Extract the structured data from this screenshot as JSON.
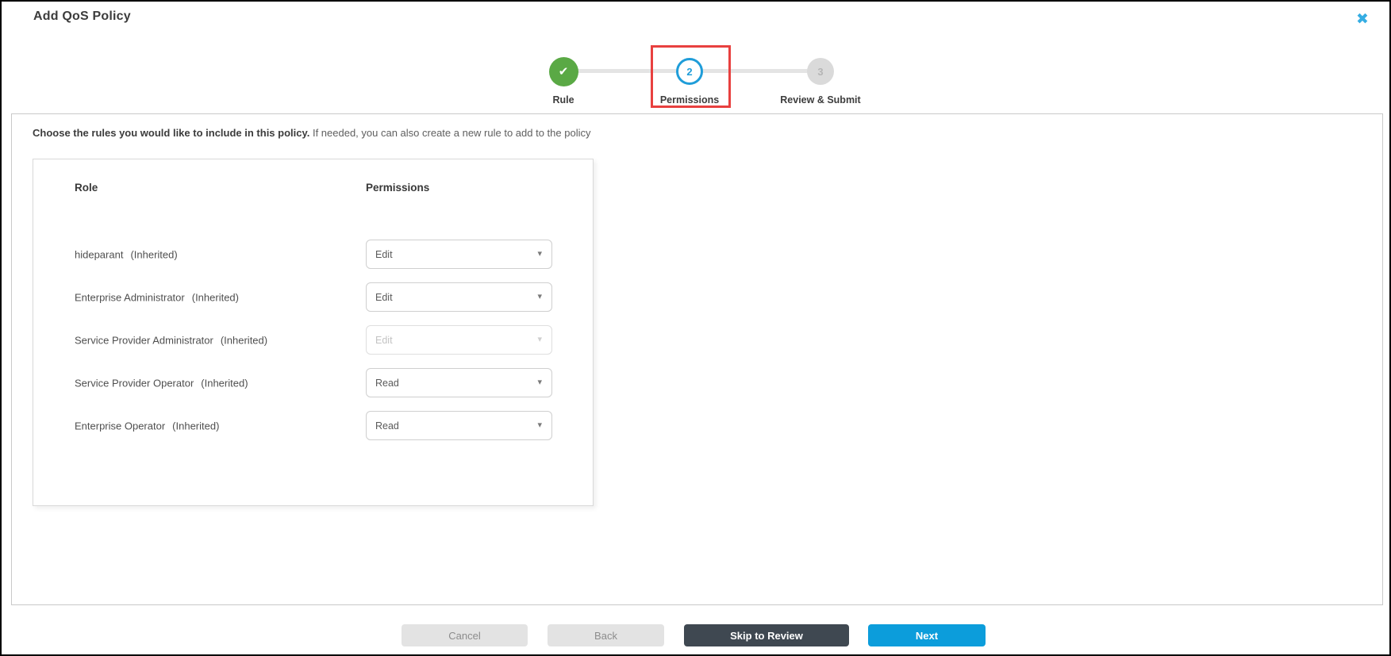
{
  "window": {
    "title": "Add QoS Policy",
    "close_icon": "✖"
  },
  "icons": {
    "check": "✔",
    "caret": "▾"
  },
  "stepper": {
    "steps": [
      {
        "label": "Rule",
        "state": "complete"
      },
      {
        "label": "Permissions",
        "state": "active",
        "number": "2"
      },
      {
        "label": "Review & Submit",
        "state": "upcoming",
        "number": "3"
      }
    ],
    "highlighted_step": "Permissions",
    "highlight_color": "#e8403f",
    "complete_color": "#5aa945",
    "active_color": "#1f9dd9",
    "upcoming_color": "#dadada"
  },
  "instruction": {
    "bold": "Choose the rules you would like to include in this policy.",
    "regular": " If needed, you can also create a new rule to add to the policy"
  },
  "permissions_table": {
    "columns": [
      "Role",
      "Permissions"
    ],
    "rows": [
      {
        "role": "hideparant",
        "suffix": "(Inherited)",
        "permission": "Edit",
        "disabled": false
      },
      {
        "role": "Enterprise Administrator",
        "suffix": "(Inherited)",
        "permission": "Edit",
        "disabled": false
      },
      {
        "role": "Service Provider Administrator",
        "suffix": "(Inherited)",
        "permission": "Edit",
        "disabled": true
      },
      {
        "role": "Service Provider Operator",
        "suffix": "(Inherited)",
        "permission": "Read",
        "disabled": false
      },
      {
        "role": "Enterprise Operator",
        "suffix": "(Inherited)",
        "permission": "Read",
        "disabled": false
      }
    ]
  },
  "footer": {
    "cancel": "Cancel",
    "back": "Back",
    "skip": "Skip to Review",
    "next": "Next",
    "next_color": "#0c9ddb",
    "skip_color": "#3f4851"
  }
}
